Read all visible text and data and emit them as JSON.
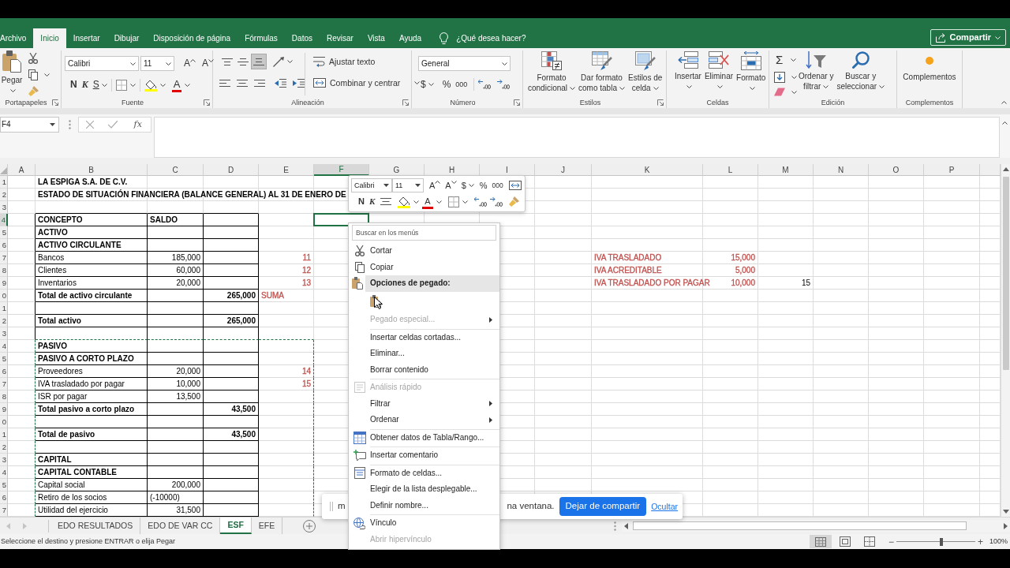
{
  "ribbon_tabs": [
    {
      "label": "Archivo",
      "selected": false
    },
    {
      "label": "Inicio",
      "selected": true
    },
    {
      "label": "Insertar",
      "selected": false
    },
    {
      "label": "Dibujar",
      "selected": false
    },
    {
      "label": "Disposición de página",
      "selected": false
    },
    {
      "label": "Fórmulas",
      "selected": false
    },
    {
      "label": "Datos",
      "selected": false
    },
    {
      "label": "Revisar",
      "selected": false
    },
    {
      "label": "Vista",
      "selected": false
    },
    {
      "label": "Ayuda",
      "selected": false
    }
  ],
  "tell_me": "¿Qué desea hacer?",
  "share_button": "Compartir",
  "ribbon": {
    "clipboard": {
      "paste": "Pegar",
      "label": "Portapapeles"
    },
    "font": {
      "font_name": "Calibri",
      "font_size": "11",
      "grow": "A",
      "shrink": "A",
      "bold": "N",
      "italic": "K",
      "underline": "S",
      "font_color": "A",
      "label": "Fuente"
    },
    "alignment": {
      "vertical": [
        {
          "selected": false
        },
        {
          "selected": false
        },
        {
          "selected": true
        }
      ],
      "wrap_text": "Ajustar texto",
      "merge": "Combinar y centrar",
      "label": "Alineación"
    },
    "number": {
      "format": "General",
      "currency": "$",
      "percent": "%",
      "thousands": "000",
      "label": "Número"
    },
    "styles": {
      "buttons": [
        {
          "lines": [
            "Formato",
            "condicional"
          ]
        },
        {
          "lines": [
            "Dar formato",
            "como tabla"
          ]
        },
        {
          "lines": [
            "Estilos de",
            "celda"
          ]
        }
      ],
      "label": "Estilos"
    },
    "cells": {
      "buttons": [
        "Insertar",
        "Eliminar",
        "Formato"
      ],
      "label": "Celdas"
    },
    "editing": {
      "autosum": "Σ",
      "buttons": [
        {
          "lines": [
            "Ordenar y",
            "filtrar"
          ]
        },
        {
          "lines": [
            "Buscar y",
            "seleccionar"
          ]
        }
      ],
      "label": "Edición"
    },
    "addins": {
      "button": "Complementos",
      "label": "Complementos"
    }
  },
  "formula_bar": {
    "name_box": "F4",
    "function_label": "fx"
  },
  "columns": [
    {
      "label": "A",
      "selected": false
    },
    {
      "label": "B",
      "selected": false
    },
    {
      "label": "C",
      "selected": false
    },
    {
      "label": "D",
      "selected": false
    },
    {
      "label": "E",
      "selected": false
    },
    {
      "label": "F",
      "selected": true
    },
    {
      "label": "G",
      "selected": false
    },
    {
      "label": "H",
      "selected": false
    },
    {
      "label": "I",
      "selected": false
    },
    {
      "label": "J",
      "selected": false
    },
    {
      "label": "K",
      "selected": false
    },
    {
      "label": "L",
      "selected": false
    },
    {
      "label": "M",
      "selected": false
    },
    {
      "label": "N",
      "selected": false
    },
    {
      "label": "O",
      "selected": false
    },
    {
      "label": "P",
      "selected": false
    }
  ],
  "rows": [
    {
      "label": "1",
      "selected": false,
      "cells": [
        null,
        {
          "text": "LA ESPIGA S.A. DE C.V.",
          "kind": "text",
          "bold": true,
          "boxed": false,
          "cut": false
        }
      ]
    },
    {
      "label": "2",
      "selected": false,
      "cells": [
        null,
        {
          "text": "ESTADO DE SITUACIÓN FINANCIERA (BALANCE GENERAL) AL 31 DE ENERO DE",
          "kind": "text",
          "bold": true,
          "boxed": false,
          "cut": false
        }
      ]
    },
    {
      "label": "3",
      "selected": false
    },
    {
      "label": "4",
      "selected": true,
      "cells": [
        null,
        {
          "text": "CONCEPTO",
          "kind": "text",
          "bold": true,
          "boxed": true,
          "cut": false
        },
        {
          "text": "SALDO",
          "kind": "text",
          "bold": true,
          "boxed": true,
          "cut": false
        },
        {
          "boxed": true,
          "cut": false
        }
      ]
    },
    {
      "label": "5",
      "selected": false,
      "cells": [
        null,
        {
          "text": "ACTIVO",
          "kind": "text",
          "bold": true,
          "boxed": true,
          "cut": false
        },
        {
          "boxed": true,
          "cut": false
        },
        {
          "boxed": true,
          "cut": false
        }
      ]
    },
    {
      "label": "6",
      "selected": false,
      "cells": [
        null,
        {
          "text": "ACTIVO CIRCULANTE",
          "kind": "text",
          "bold": true,
          "boxed": true,
          "cut": false
        },
        {
          "boxed": true,
          "cut": false
        },
        {
          "boxed": true,
          "cut": false
        }
      ]
    },
    {
      "label": "7",
      "selected": false,
      "cells": [
        null,
        {
          "text": "Bancos",
          "kind": "text",
          "bold": false,
          "boxed": true,
          "cut": false
        },
        {
          "text": "185,000",
          "kind": "number",
          "bold": false,
          "boxed": true,
          "cut": false
        },
        {
          "boxed": true,
          "cut": false
        },
        {
          "text": "11",
          "kind": "number",
          "bold": false,
          "color": "#c0504d",
          "boxed": false,
          "cut": false
        },
        null,
        null,
        null,
        null,
        null,
        {
          "text": "IVA TRASLADADO",
          "kind": "text",
          "bold": false,
          "color": "#c0504d",
          "boxed": false,
          "cut": false
        },
        {
          "text": "15,000",
          "kind": "number",
          "bold": false,
          "color": "#c0504d",
          "boxed": false,
          "cut": false
        }
      ]
    },
    {
      "label": "8",
      "selected": false,
      "cells": [
        null,
        {
          "text": "Clientes",
          "kind": "text",
          "bold": false,
          "boxed": true,
          "cut": false
        },
        {
          "text": "60,000",
          "kind": "number",
          "bold": false,
          "boxed": true,
          "cut": false
        },
        {
          "boxed": true,
          "cut": false
        },
        {
          "text": "12",
          "kind": "number",
          "bold": false,
          "color": "#c0504d",
          "boxed": false,
          "cut": false
        },
        null,
        null,
        null,
        null,
        null,
        {
          "text": "IVA ACREDITABLE",
          "kind": "text",
          "bold": false,
          "color": "#c0504d",
          "boxed": false,
          "cut": false
        },
        {
          "text": "5,000",
          "kind": "number",
          "bold": false,
          "color": "#c0504d",
          "boxed": false,
          "cut": false
        }
      ]
    },
    {
      "label": "9",
      "selected": false,
      "cells": [
        null,
        {
          "text": "Inventarios",
          "kind": "text",
          "bold": false,
          "boxed": true,
          "cut": false
        },
        {
          "text": "20,000",
          "kind": "number",
          "bold": false,
          "boxed": true,
          "cut": false
        },
        {
          "boxed": true,
          "cut": false
        },
        {
          "text": "13",
          "kind": "number",
          "bold": false,
          "color": "#c0504d",
          "boxed": false,
          "cut": false
        },
        null,
        null,
        null,
        null,
        null,
        {
          "text": "IVA TRASLADADO POR PAGAR",
          "kind": "text",
          "bold": false,
          "color": "#c0504d",
          "boxed": false,
          "cut": false
        },
        {
          "text": "10,000",
          "kind": "number",
          "bold": false,
          "color": "#c0504d",
          "boxed": false,
          "cut": false
        },
        {
          "text": "15",
          "kind": "number",
          "bold": false,
          "boxed": false,
          "cut": false
        }
      ]
    },
    {
      "label": "0",
      "selected": false,
      "cells": [
        null,
        {
          "text": "Total de activo circulante",
          "kind": "text",
          "bold": true,
          "boxed": true,
          "cut": false
        },
        {
          "boxed": true,
          "cut": false
        },
        {
          "text": "265,000",
          "kind": "number",
          "bold": true,
          "boxed": true,
          "cut": false
        },
        {
          "text": "SUMA",
          "kind": "text",
          "bold": false,
          "color": "#c0504d",
          "boxed": false,
          "cut": false
        }
      ]
    },
    {
      "label": "1",
      "selected": false,
      "cells": [
        null,
        {
          "boxed": true,
          "cut": false
        },
        {
          "boxed": true,
          "cut": false
        },
        {
          "boxed": true,
          "cut": false
        }
      ]
    },
    {
      "label": "2",
      "selected": false,
      "cells": [
        null,
        {
          "text": "Total activo",
          "kind": "text",
          "bold": true,
          "boxed": true,
          "cut": false
        },
        {
          "boxed": true,
          "cut": false
        },
        {
          "text": "265,000",
          "kind": "number",
          "bold": true,
          "boxed": true,
          "cut": false
        }
      ]
    },
    {
      "label": "3",
      "selected": false,
      "cells": [
        null,
        {
          "boxed": true,
          "cut": false
        },
        {
          "boxed": true,
          "cut": false
        },
        {
          "boxed": true,
          "cut": false
        }
      ]
    },
    {
      "label": "4",
      "selected": false,
      "cells": [
        null,
        {
          "text": "PASIVO",
          "kind": "text",
          "bold": true,
          "boxed": true,
          "cut": true
        },
        {
          "boxed": true,
          "cut": true
        },
        {
          "boxed": true,
          "cut": true
        },
        {
          "boxed": false,
          "cut": true
        }
      ]
    },
    {
      "label": "5",
      "selected": false,
      "cells": [
        null,
        {
          "text": "PASIVO A CORTO PLAZO",
          "kind": "text",
          "bold": true,
          "boxed": true,
          "cut": true
        },
        {
          "boxed": true,
          "cut": true
        },
        {
          "boxed": true,
          "cut": true
        },
        {
          "boxed": false,
          "cut": true
        }
      ]
    },
    {
      "label": "6",
      "selected": false,
      "cells": [
        null,
        {
          "text": "Proveedores",
          "kind": "text",
          "bold": false,
          "boxed": true,
          "cut": true
        },
        {
          "text": "20,000",
          "kind": "number",
          "bold": false,
          "boxed": true,
          "cut": true
        },
        {
          "boxed": true,
          "cut": true
        },
        {
          "text": "14",
          "kind": "number",
          "bold": false,
          "color": "#c0504d",
          "boxed": false,
          "cut": true
        }
      ]
    },
    {
      "label": "7",
      "selected": false,
      "cells": [
        null,
        {
          "text": "IVA trasladado por pagar",
          "kind": "text",
          "bold": false,
          "boxed": true,
          "cut": true
        },
        {
          "text": "10,000",
          "kind": "number",
          "bold": false,
          "boxed": true,
          "cut": true
        },
        {
          "boxed": true,
          "cut": true
        },
        {
          "text": "15",
          "kind": "number",
          "bold": false,
          "color": "#c0504d",
          "boxed": false,
          "cut": true
        }
      ]
    },
    {
      "label": "8",
      "selected": false,
      "cells": [
        null,
        {
          "text": "ISR por pagar",
          "kind": "text",
          "bold": false,
          "boxed": true,
          "cut": true
        },
        {
          "text": "13,500",
          "kind": "number",
          "bold": false,
          "boxed": true,
          "cut": true
        },
        {
          "boxed": true,
          "cut": true
        },
        {
          "boxed": false,
          "cut": true
        }
      ]
    },
    {
      "label": "9",
      "selected": false,
      "cells": [
        null,
        {
          "text": "Total pasivo a corto plazo",
          "kind": "text",
          "bold": true,
          "boxed": true,
          "cut": true
        },
        {
          "boxed": true,
          "cut": true
        },
        {
          "text": "43,500",
          "kind": "number",
          "bold": true,
          "boxed": true,
          "cut": true
        },
        {
          "boxed": false,
          "cut": true
        }
      ]
    },
    {
      "label": "0",
      "selected": false,
      "cells": [
        null,
        {
          "boxed": true,
          "cut": true
        },
        {
          "boxed": true,
          "cut": true
        },
        {
          "boxed": true,
          "cut": true
        },
        {
          "boxed": false,
          "cut": true
        }
      ]
    },
    {
      "label": "1",
      "selected": false,
      "cells": [
        null,
        {
          "text": "Total de pasivo",
          "kind": "text",
          "bold": true,
          "boxed": true,
          "cut": true
        },
        {
          "boxed": true,
          "cut": true
        },
        {
          "text": "43,500",
          "kind": "number",
          "bold": true,
          "boxed": true,
          "cut": true
        },
        {
          "boxed": false,
          "cut": true
        }
      ]
    },
    {
      "label": "2",
      "selected": false,
      "cells": [
        null,
        {
          "boxed": true,
          "cut": true
        },
        {
          "boxed": true,
          "cut": true
        },
        {
          "boxed": true,
          "cut": true
        },
        {
          "boxed": false,
          "cut": true
        }
      ]
    },
    {
      "label": "3",
      "selected": false,
      "cells": [
        null,
        {
          "text": "CAPITAL",
          "kind": "text",
          "bold": true,
          "boxed": true,
          "cut": true
        },
        {
          "boxed": true,
          "cut": true
        },
        {
          "boxed": true,
          "cut": true
        },
        {
          "boxed": false,
          "cut": true
        }
      ]
    },
    {
      "label": "4",
      "selected": false,
      "cells": [
        null,
        {
          "text": "CAPITAL CONTABLE",
          "kind": "text",
          "bold": true,
          "boxed": true,
          "cut": true
        },
        {
          "boxed": true,
          "cut": true
        },
        {
          "boxed": true,
          "cut": true
        },
        {
          "boxed": false,
          "cut": true
        }
      ]
    },
    {
      "label": "5",
      "selected": false,
      "cells": [
        null,
        {
          "text": "Capital social",
          "kind": "text",
          "bold": false,
          "boxed": true,
          "cut": true
        },
        {
          "text": "200,000",
          "kind": "number",
          "bold": false,
          "boxed": true,
          "cut": true
        },
        {
          "boxed": true,
          "cut": true
        },
        {
          "boxed": false,
          "cut": true
        }
      ]
    },
    {
      "label": "6",
      "selected": false,
      "cells": [
        null,
        {
          "text": "Retiro de los socios",
          "kind": "text",
          "bold": false,
          "boxed": true,
          "cut": true
        },
        {
          "text": "(-10000)",
          "kind": "text",
          "bold": false,
          "boxed": true,
          "cut": true
        },
        {
          "boxed": true,
          "cut": true
        },
        {
          "boxed": false,
          "cut": true
        }
      ]
    },
    {
      "label": "7",
      "selected": false,
      "cells": [
        null,
        {
          "text": "Utilidad del ejercicio",
          "kind": "text",
          "bold": false,
          "boxed": true,
          "cut": true
        },
        {
          "text": "31,500",
          "kind": "number",
          "bold": false,
          "boxed": true,
          "cut": true
        },
        {
          "boxed": true,
          "cut": true
        },
        {
          "boxed": false,
          "cut": true
        }
      ]
    }
  ],
  "sheet_tabs": [
    {
      "label": "EDO RESULTADOS",
      "selected": false
    },
    {
      "label": "EDO DE VAR CC",
      "selected": false
    },
    {
      "label": "ESF",
      "selected": true
    },
    {
      "label": "EFE",
      "selected": false
    }
  ],
  "status_bar": {
    "message": "Seleccione el destino y presione ENTRAR o elija Pegar",
    "views": [
      {
        "selected": true
      },
      {
        "selected": false
      },
      {
        "selected": false
      }
    ],
    "zoom_out": "−",
    "zoom": {
      "level": 0.57
    },
    "zoom_in": "+",
    "zoom_label": "100%"
  },
  "mini_toolbar": {
    "font_name": "Calibri",
    "font_size": "11",
    "grow": "A",
    "shrink": "A",
    "currency": "$",
    "percent": "%",
    "thousands": "000",
    "bold": "N",
    "italic": "K",
    "font_color": "A"
  },
  "context_menu": {
    "search": {
      "placeholder": "Buscar en los menús"
    },
    "sections": [
      {
        "items": [
          {
            "kind": "item",
            "label": "Cortar",
            "disabled": false,
            "submenu": false
          },
          {
            "kind": "item",
            "label": "Copiar",
            "disabled": false,
            "submenu": false
          },
          {
            "kind": "header",
            "label": "Opciones de pegado:"
          },
          {
            "kind": "paste_icons"
          },
          {
            "kind": "item",
            "label": "Pegado especial...",
            "disabled": true,
            "submenu": true
          }
        ]
      },
      {
        "items": [
          {
            "kind": "item",
            "label": "Insertar celdas cortadas...",
            "disabled": false,
            "submenu": false
          },
          {
            "kind": "item",
            "label": "Eliminar...",
            "disabled": false,
            "submenu": false
          },
          {
            "kind": "item",
            "label": "Borrar contenido",
            "disabled": false,
            "submenu": false
          }
        ]
      },
      {
        "items": [
          {
            "kind": "item",
            "label": "Análisis rápido",
            "disabled": true,
            "submenu": false
          },
          {
            "kind": "item",
            "label": "Filtrar",
            "disabled": false,
            "submenu": true
          },
          {
            "kind": "item",
            "label": "Ordenar",
            "disabled": false,
            "submenu": true
          }
        ]
      },
      {
        "items": [
          {
            "kind": "item",
            "label": "Obtener datos de Tabla/Rango...",
            "disabled": false,
            "submenu": false
          }
        ]
      },
      {
        "items": [
          {
            "kind": "item",
            "label": "Insertar comentario",
            "disabled": false,
            "submenu": false
          }
        ]
      },
      {
        "items": [
          {
            "kind": "item",
            "label": "Formato de celdas...",
            "disabled": false,
            "submenu": false
          },
          {
            "kind": "item",
            "label": "Elegir de la lista desplegable...",
            "disabled": false,
            "submenu": false
          },
          {
            "kind": "item",
            "label": "Definir nombre...",
            "disabled": false,
            "submenu": false
          }
        ]
      },
      {
        "items": [
          {
            "kind": "item",
            "label": "Vínculo",
            "disabled": false,
            "submenu": false
          },
          {
            "kind": "item",
            "label": "Abrir hipervínculo",
            "disabled": true,
            "submenu": false
          }
        ]
      }
    ]
  },
  "share_bar": {
    "text_start": "m",
    "text_end": "na ventana.",
    "button": "Dejar de compartir",
    "link": "Ocultar"
  }
}
